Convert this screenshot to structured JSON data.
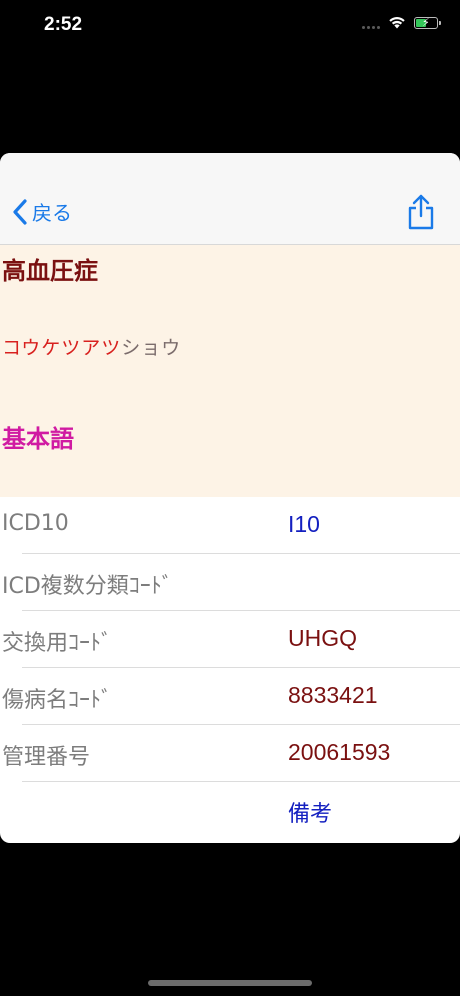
{
  "status_bar": {
    "time": "2:52",
    "battery_level": 0.55
  },
  "nav": {
    "back_label": "戻る",
    "share_icon": "share-icon"
  },
  "term": {
    "title": "高血圧症",
    "reading_part1": "コウケツアツ",
    "reading_part2": "ショウ",
    "category": "基本語"
  },
  "details": {
    "icd10_label": "ICD10",
    "icd10_value": "I10",
    "icd_multi_label": "ICD複数分類ｺｰﾄﾞ",
    "exchange_label": "交換用ｺｰﾄﾞ",
    "exchange_value": "UHGQ",
    "disease_code_label": "傷病名ｺｰﾄﾞ",
    "disease_code_value": "8833421",
    "mgmt_label": "管理番号",
    "mgmt_value": "20061593",
    "notes_link": "備考"
  },
  "colors": {
    "accent": "#1a7ae8",
    "title": "#7a1010",
    "category": "#d01aa2",
    "reading_highlight": "#d8201e"
  }
}
